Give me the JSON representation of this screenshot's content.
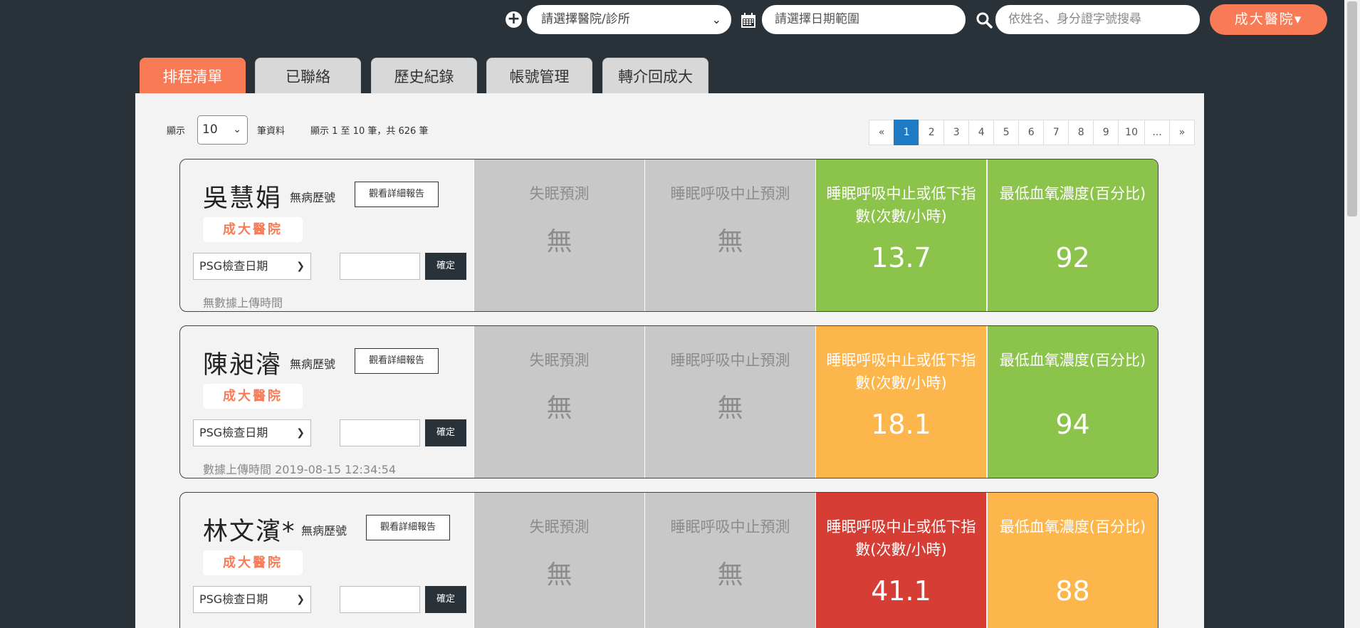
{
  "topbar": {
    "hospital_placeholder": "請選擇醫院/診所",
    "date_placeholder": "請選擇日期範圍",
    "search_placeholder": "依姓名、身分證字號搜尋",
    "hospital_button": "成大醫院▾"
  },
  "tabs": [
    {
      "label": "排程清單",
      "active": true
    },
    {
      "label": "已聯絡",
      "active": false
    },
    {
      "label": "歷史紀錄",
      "active": false
    },
    {
      "label": "帳號管理",
      "active": false
    },
    {
      "label": "轉介回成大",
      "active": false
    }
  ],
  "table": {
    "show_label": "顯示",
    "page_size": "10",
    "records_label": "筆資料",
    "info": "顯示 1 至 10 筆，共 626 筆"
  },
  "pagination": [
    "«",
    "1",
    "2",
    "3",
    "4",
    "5",
    "6",
    "7",
    "8",
    "9",
    "10",
    "...",
    "»"
  ],
  "pagination_active": "1",
  "patients": [
    {
      "name": "吳慧娟",
      "record": "無病歷號",
      "report_button": "觀看詳細報告",
      "hospital": "成大醫院",
      "psg_select": "PSG檢查日期",
      "confirm": "確定",
      "upload_time": "無數據上傳時間",
      "insomnia_label": "失眠預測",
      "insomnia_value": "無",
      "apnea_label": "睡眠呼吸中止預測",
      "apnea_value": "無",
      "ahi_label": "睡眠呼吸中止或低下指數(次數/小時)",
      "ahi_value": "13.7",
      "ahi_color": "#8cc34a",
      "spo2_label": "最低血氧濃度(百分比)",
      "spo2_value": "92",
      "spo2_color": "#8cc34a"
    },
    {
      "name": "陳昶濬",
      "record": "無病歷號",
      "report_button": "觀看詳細報告",
      "hospital": "成大醫院",
      "psg_select": "PSG檢查日期",
      "confirm": "確定",
      "upload_time": "數據上傳時間 2019-08-15 12:34:54",
      "insomnia_label": "失眠預測",
      "insomnia_value": "無",
      "apnea_label": "睡眠呼吸中止預測",
      "apnea_value": "無",
      "ahi_label": "睡眠呼吸中止或低下指數(次數/小時)",
      "ahi_value": "18.1",
      "ahi_color": "#fdb64b",
      "spo2_label": "最低血氧濃度(百分比)",
      "spo2_value": "94",
      "spo2_color": "#8cc34a"
    },
    {
      "name": "林文濱*",
      "record": "無病歷號",
      "report_button": "觀看詳細報告",
      "hospital": "成大醫院",
      "psg_select": "PSG檢查日期",
      "confirm": "確定",
      "upload_time": "",
      "insomnia_label": "失眠預測",
      "insomnia_value": "無",
      "apnea_label": "睡眠呼吸中止預測",
      "apnea_value": "無",
      "ahi_label": "睡眠呼吸中止或低下指數(次數/小時)",
      "ahi_value": "41.1",
      "ahi_color": "#d63d35",
      "spo2_label": "最低血氧濃度(百分比)",
      "spo2_value": "88",
      "spo2_color": "#fdb64b"
    }
  ]
}
